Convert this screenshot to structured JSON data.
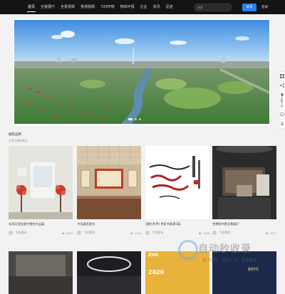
{
  "header": {
    "nav": [
      "首页",
      "全景展厅",
      "全景视频",
      "普通视频",
      "720环物",
      "物体环视",
      "企业",
      "资讯",
      "足迹"
    ],
    "search_placeholder": "搜索",
    "publish_label": "发布",
    "login_label": "登录"
  },
  "sidebar": {
    "items": [
      {
        "label": "",
        "icon": "grid-icon"
      },
      {
        "label": "",
        "icon": "share-icon"
      },
      {
        "label": "我要上传",
        "icon": "upload-icon"
      },
      {
        "label": "",
        "icon": "chat-icon"
      },
      {
        "label": "",
        "icon": "top-icon"
      }
    ]
  },
  "section": {
    "title": "推荐品牌",
    "subtitle": "分享全景的美好"
  },
  "cards": [
    {
      "title": "长风万里五星守望合作品展",
      "author": "华视景观",
      "views": "2509"
    },
    {
      "title": "书法展览室内",
      "author": "华视景观",
      "views": "2130"
    },
    {
      "title": "(湘尔艺术) 京家书画第1展",
      "author": "华视景观",
      "views": "2086"
    },
    {
      "title": "世界图书馆全景展厅",
      "author": "华视景观",
      "views": "2011"
    }
  ],
  "row2_labels": {
    "card3_top": "ZHO",
    "card3_year": "2020",
    "card4_tag": "新时代"
  },
  "watermark": {
    "brand": "自动秒收录",
    "slogan": "做上精榜 · 来访一次 · 自动收录"
  },
  "colors": {
    "topbar": "#141414",
    "accent": "#2f7cf6",
    "page_bg": "#f2f2f2"
  }
}
